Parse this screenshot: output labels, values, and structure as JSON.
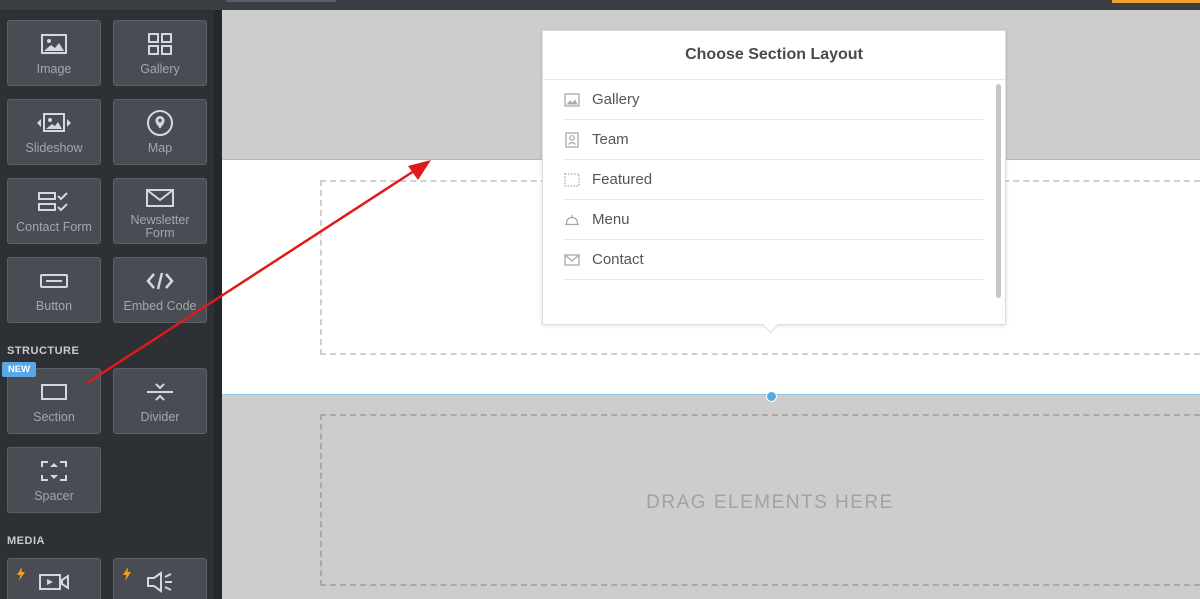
{
  "sidebar": {
    "tiles": [
      {
        "label": "Image",
        "icon": "image-icon"
      },
      {
        "label": "Gallery",
        "icon": "gallery-grid-icon"
      },
      {
        "label": "Slideshow",
        "icon": "slideshow-icon"
      },
      {
        "label": "Map",
        "icon": "map-pin-icon"
      },
      {
        "label": "Contact Form",
        "icon": "contact-form-icon"
      },
      {
        "label": "Newsletter Form",
        "icon": "envelope-icon"
      },
      {
        "label": "Button",
        "icon": "button-icon"
      },
      {
        "label": "Embed Code",
        "icon": "code-icon"
      },
      {
        "label": "Section",
        "icon": "section-icon",
        "badge": "NEW"
      },
      {
        "label": "Divider",
        "icon": "divider-icon"
      },
      {
        "label": "Spacer",
        "icon": "spacer-icon"
      },
      {
        "label": "",
        "icon": "video-icon",
        "premium": true
      },
      {
        "label": "",
        "icon": "audio-icon",
        "premium": true
      }
    ],
    "headings": {
      "structure": "STRUCTURE",
      "media": "MEDIA"
    }
  },
  "popup": {
    "title": "Choose Section Layout",
    "items": [
      {
        "label": "Gallery",
        "icon": "image-icon"
      },
      {
        "label": "Team",
        "icon": "person-card-icon"
      },
      {
        "label": "Featured",
        "icon": "dotted-box-icon"
      },
      {
        "label": "Menu",
        "icon": "cloche-icon"
      },
      {
        "label": "Contact",
        "icon": "envelope-icon"
      }
    ]
  },
  "canvas": {
    "dropzone_text": "DRAG ELEMENTS HERE"
  },
  "colors": {
    "sidebar_bg": "#2d3034",
    "tile_bg": "#494d53",
    "accent_blue": "#5aa7e6",
    "bolt_orange": "#f0a020",
    "arrow_red": "#e01a1a"
  }
}
